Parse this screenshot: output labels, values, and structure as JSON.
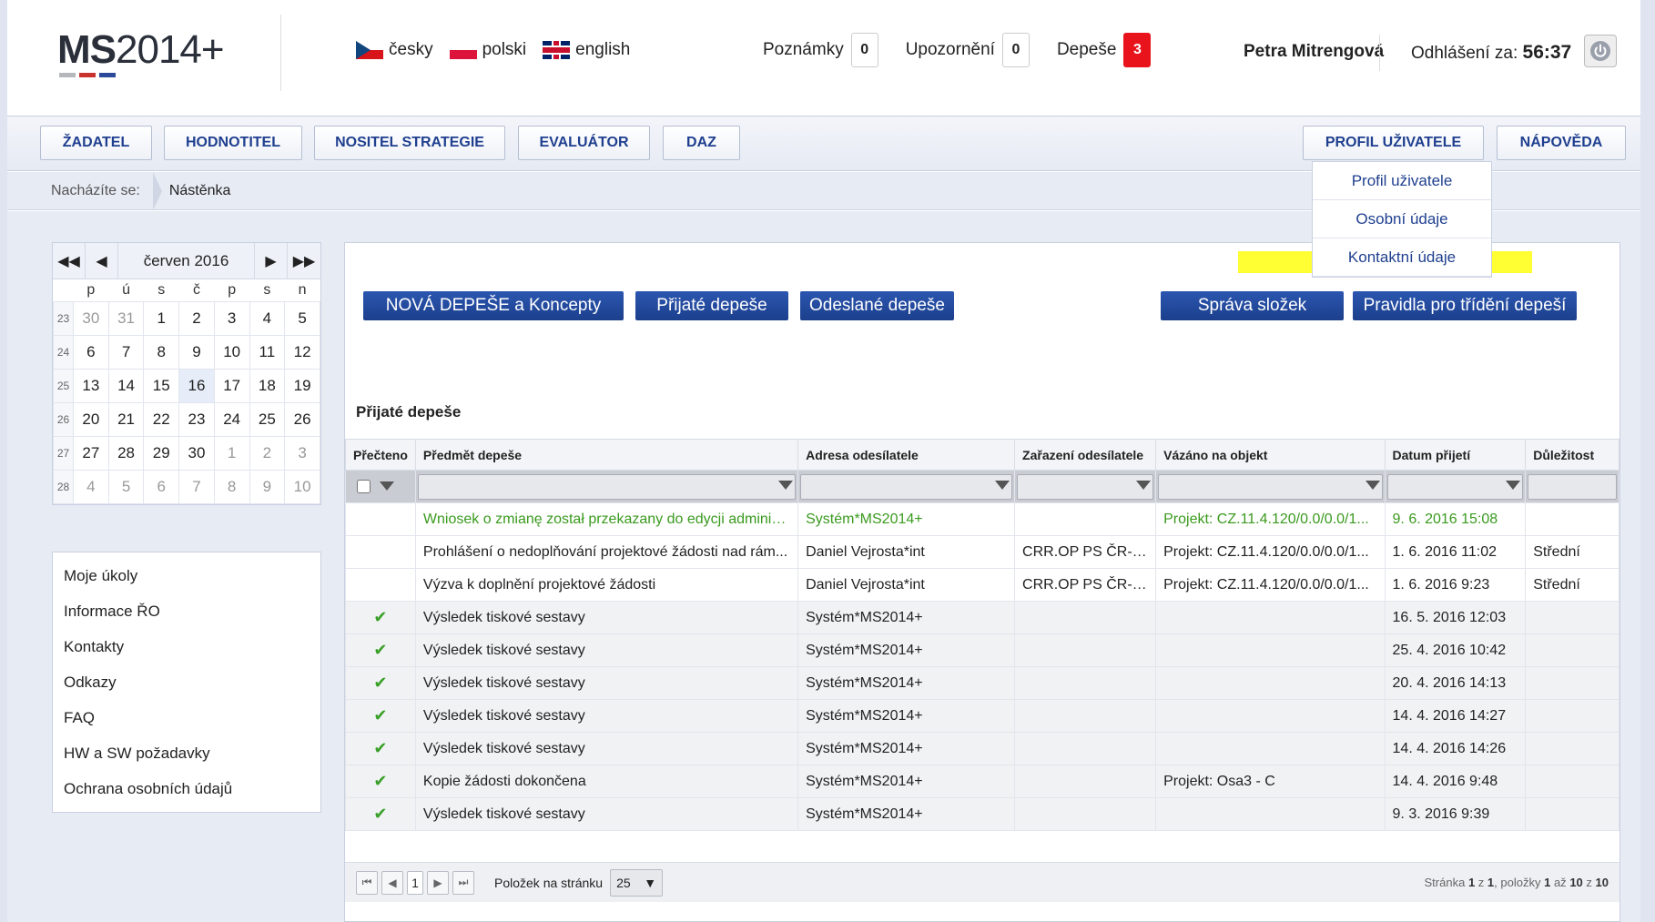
{
  "header": {
    "logo_bold": "MS",
    "logo_light": "2014+",
    "logo_bar_colors": [
      "#b5b7bb",
      "#c8332e",
      "#2b4a9a"
    ],
    "languages": [
      {
        "label": "česky",
        "icon": "flag-cz-icon"
      },
      {
        "label": "polski",
        "icon": "flag-pl-icon"
      },
      {
        "label": "english",
        "icon": "flag-en-icon"
      }
    ],
    "counters": [
      {
        "label": "Poznámky",
        "value": "0"
      },
      {
        "label": "Upozornění",
        "value": "0"
      },
      {
        "label": "Depeše",
        "value": "3"
      }
    ],
    "user_name": "Petra Mitrengová",
    "logout_label": "Odhlášení za:",
    "logout_time": "56:37",
    "power_icon": "power-icon"
  },
  "nav": {
    "items": [
      "ŽADATEL",
      "HODNOTITEL",
      "NOSITEL STRATEGIE",
      "EVALUÁTOR",
      "DAZ"
    ],
    "profile": "PROFIL UŽIVATELE",
    "help": "NÁPOVĚDA",
    "dropdown": [
      "Profil uživatele",
      "Osobní údaje",
      "Kontaktní údaje"
    ],
    "highlight_color": "#ffff33"
  },
  "breadcrumb": {
    "here_label": "Nacházíte se:",
    "current": "Nástěnka"
  },
  "calendar": {
    "month": "červen 2016",
    "weekdays": [
      "p",
      "ú",
      "s",
      "č",
      "p",
      "s",
      "n"
    ],
    "weeks": [
      {
        "wk": "23",
        "days": [
          "30",
          "31",
          "1",
          "2",
          "3",
          "4",
          "5"
        ]
      },
      {
        "wk": "24",
        "days": [
          "6",
          "7",
          "8",
          "9",
          "10",
          "11",
          "12"
        ]
      },
      {
        "wk": "25",
        "days": [
          "13",
          "14",
          "15",
          "16",
          "17",
          "18",
          "19"
        ]
      },
      {
        "wk": "26",
        "days": [
          "20",
          "21",
          "22",
          "23",
          "24",
          "25",
          "26"
        ]
      },
      {
        "wk": "27",
        "days": [
          "27",
          "28",
          "29",
          "30",
          "1",
          "2",
          "3"
        ]
      },
      {
        "wk": "28",
        "days": [
          "4",
          "5",
          "6",
          "7",
          "8",
          "9",
          "10"
        ]
      }
    ],
    "today": "16"
  },
  "side_menu": [
    "Moje úkoly",
    "Informace ŘO",
    "Kontakty",
    "Odkazy",
    "FAQ",
    "HW a SW požadavky",
    "Ochrana osobních údajů"
  ],
  "main": {
    "buttons": {
      "new": "NOVÁ DEPEŠE a Koncepty",
      "received": "Přijaté depeše",
      "sent": "Odeslané depeše",
      "folders": "Správa složek",
      "rules": "Pravidla pro třídění depeší"
    },
    "section_title": "Přijaté depeše",
    "columns": [
      "Přečteno",
      "Předmět depeše",
      "Adresa odesílatele",
      "Zařazení odesílatele",
      "Vázáno na objekt",
      "Datum přijetí",
      "Důležitost"
    ],
    "rows": [
      {
        "read": false,
        "subject": "Wniosek o zmianę został przekazany do edycji adminis...",
        "sender": "Systém*MS2014+",
        "category": "",
        "object": "Projekt: CZ.11.4.120/0.0/0.0/1...",
        "date": "9. 6. 2016 15:08",
        "importance": "",
        "green": true
      },
      {
        "read": false,
        "subject": "Prohlášení o nedoplňování projektové žádosti nad rám...",
        "sender": "Daniel Vejrosta*int",
        "category": "CRR.OP PS ČR-PL",
        "object": "Projekt: CZ.11.4.120/0.0/0.0/1...",
        "date": "1. 6. 2016 11:02",
        "importance": "Střední",
        "green": false
      },
      {
        "read": false,
        "subject": "Výzva k doplnění projektové žádosti",
        "sender": "Daniel Vejrosta*int",
        "category": "CRR.OP PS ČR-PL",
        "object": "Projekt: CZ.11.4.120/0.0/0.0/1...",
        "date": "1. 6. 2016 9:23",
        "importance": "Střední",
        "green": false
      },
      {
        "read": true,
        "subject": "Výsledek tiskové sestavy",
        "sender": "Systém*MS2014+",
        "category": "",
        "object": "",
        "date": "16. 5. 2016 12:03",
        "importance": "",
        "green": false
      },
      {
        "read": true,
        "subject": "Výsledek tiskové sestavy",
        "sender": "Systém*MS2014+",
        "category": "",
        "object": "",
        "date": "25. 4. 2016 10:42",
        "importance": "",
        "green": false
      },
      {
        "read": true,
        "subject": "Výsledek tiskové sestavy",
        "sender": "Systém*MS2014+",
        "category": "",
        "object": "",
        "date": "20. 4. 2016 14:13",
        "importance": "",
        "green": false
      },
      {
        "read": true,
        "subject": "Výsledek tiskové sestavy",
        "sender": "Systém*MS2014+",
        "category": "",
        "object": "",
        "date": "14. 4. 2016 14:27",
        "importance": "",
        "green": false
      },
      {
        "read": true,
        "subject": "Výsledek tiskové sestavy",
        "sender": "Systém*MS2014+",
        "category": "",
        "object": "",
        "date": "14. 4. 2016 14:26",
        "importance": "",
        "green": false
      },
      {
        "read": true,
        "subject": "Kopie žádosti dokončena",
        "sender": "Systém*MS2014+",
        "category": "",
        "object": "Projekt: Osa3 - C",
        "date": "14. 4. 2016 9:48",
        "importance": "",
        "green": false
      },
      {
        "read": true,
        "subject": "Výsledek tiskové sestavy",
        "sender": "Systém*MS2014+",
        "category": "",
        "object": "",
        "date": "9. 3. 2016 9:39",
        "importance": "",
        "green": false
      }
    ],
    "pager": {
      "current_page": "1",
      "per_page_label": "Položek na stránku",
      "per_page_value": "25",
      "info_prefix": "Stránka",
      "page": "1",
      "of": "z",
      "pages": "1",
      "items_label": ", položky",
      "from": "1",
      "to_label": "až",
      "to": "10",
      "total": "10"
    }
  }
}
